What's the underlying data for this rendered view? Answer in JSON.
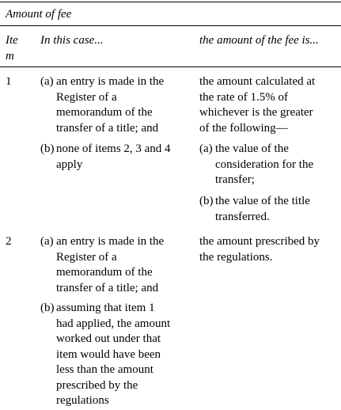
{
  "table": {
    "title": "Amount of fee",
    "headers": {
      "item": [
        "Ite",
        "m"
      ],
      "case": "In this case...",
      "amount": "the amount of the fee is..."
    },
    "rows": [
      {
        "item": "1",
        "case": [
          {
            "label": "(a)",
            "lines": [
              "an entry is made in the",
              "Register of a",
              "memorandum of the",
              "transfer of a title; and"
            ]
          },
          {
            "label": "(b)",
            "lines": [
              "none of items 2, 3 and 4",
              "apply"
            ]
          }
        ],
        "amount_intro": [
          "the amount calculated at",
          "the rate of 1.5% of",
          "whichever is the greater",
          "of the following—"
        ],
        "amount_items": [
          {
            "label": "(a)",
            "lines": [
              "the value of the",
              "consideration for the",
              "transfer;"
            ]
          },
          {
            "label": "(b)",
            "lines": [
              "the value of the title",
              "transferred."
            ]
          }
        ]
      },
      {
        "item": "2",
        "case": [
          {
            "label": "(a)",
            "lines": [
              "an entry is made in the",
              "Register of a",
              "memorandum of the",
              "transfer of a title; and"
            ]
          },
          {
            "label": "(b)",
            "lines": [
              "assuming that item 1",
              "had applied, the amount",
              "worked out under that",
              "item would have been",
              "less than the amount",
              "prescribed by the",
              "regulations"
            ]
          }
        ],
        "amount_intro": [
          "the amount prescribed by",
          "the regulations."
        ],
        "amount_items": []
      }
    ]
  }
}
